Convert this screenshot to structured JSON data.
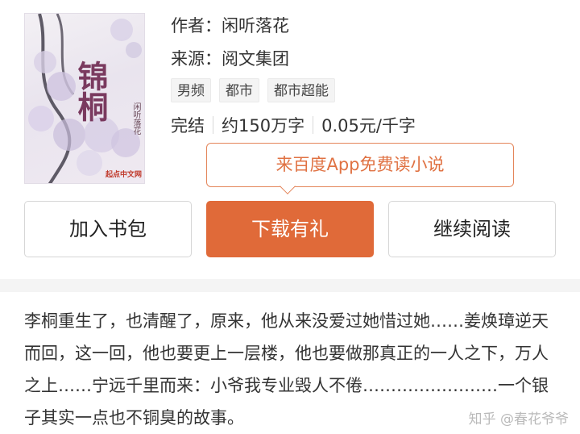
{
  "book": {
    "cover": {
      "title": "锦桐",
      "author_text": "闲听落花",
      "publisher_logo": "起点中文网"
    },
    "author_line": "作者：闲听落花",
    "source_line": "来源：阅文集团",
    "tags": [
      "男频",
      "都市",
      "都市超能"
    ],
    "status": "完结",
    "word_count": "约150万字",
    "price": "0.05元/千字"
  },
  "promo": {
    "text": "来百度App免费读小说"
  },
  "actions": {
    "add_to_shelf": "加入书包",
    "download": "下载有礼",
    "continue_reading": "继续阅读"
  },
  "description": "李桐重生了，也清醒了，原来，他从来没爱过她惜过她……姜焕璋逆天而回，这一回，他也要更上一层楼，他也要做那真正的一人之下，万人之上……宁远千里而来：小爷我专业毁人不倦……………………一个银子其实一点也不铜臭的故事。",
  "watermark": "知乎 @春花爷爷",
  "colors": {
    "accent": "#e06a39",
    "promo_text": "#e07243"
  }
}
